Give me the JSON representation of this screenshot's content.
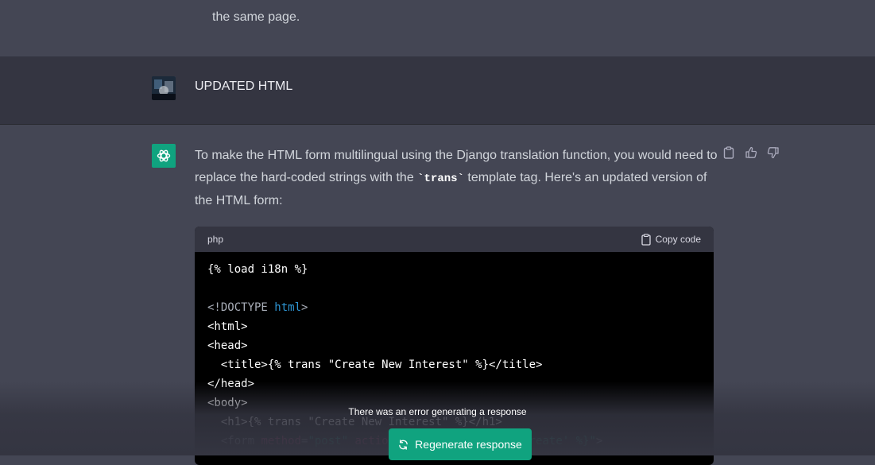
{
  "prev_message": {
    "tail_text": "the same page."
  },
  "user_message": {
    "text": "UPDATED HTML"
  },
  "assistant_message": {
    "intro_before_code": "To make the HTML form multilingual using the Django translation function, you would need to replace the hard-coded strings with the ",
    "inline_code": "`trans`",
    "intro_after_code": " template tag. Here's an updated version of the HTML form:",
    "code_block": {
      "language": "php",
      "copy_label": "Copy code"
    }
  },
  "footer": {
    "error_text": "There was an error generating a response",
    "regenerate_label": "Regenerate response"
  },
  "colors": {
    "accent": "#10a37f",
    "bg_user": "#343541",
    "bg_assistant": "#444654"
  }
}
